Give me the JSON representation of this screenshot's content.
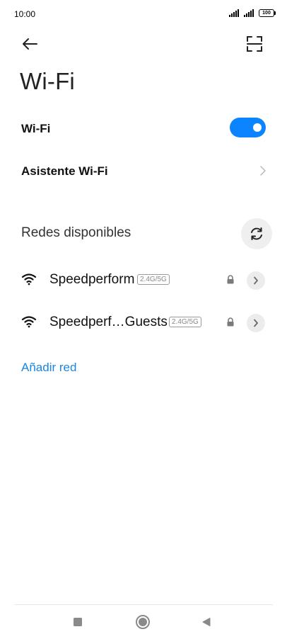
{
  "status_bar": {
    "time": "10:00",
    "battery": "100"
  },
  "header": {
    "back_icon": "arrow-left-icon",
    "scan_icon": "qr-scan-icon"
  },
  "page": {
    "title": "Wi-Fi"
  },
  "wifi_toggle": {
    "label": "Wi-Fi",
    "enabled": true,
    "accent_color": "#0d84ff"
  },
  "assistant": {
    "label": "Asistente Wi-Fi"
  },
  "available": {
    "title": "Redes disponibles",
    "refresh_icon": "refresh-icon",
    "networks": [
      {
        "name": "Speedperform",
        "band": "2.4G/5G",
        "secured": true
      },
      {
        "name": "Speedperf…Guests",
        "band": "2.4G/5G",
        "secured": true
      }
    ]
  },
  "add_network": {
    "label": "Añadir red",
    "color": "#1a86e0"
  },
  "nav": {
    "recents_icon": "square-icon",
    "home_icon": "circle-home-icon",
    "back_icon": "triangle-back-icon"
  }
}
